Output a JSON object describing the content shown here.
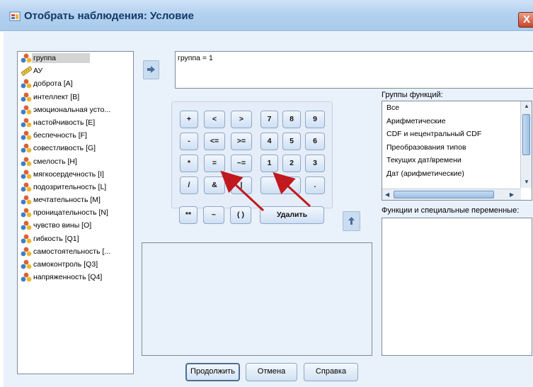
{
  "window": {
    "title": "Отобрать наблюдения: Условие",
    "close_label": "X"
  },
  "variables": [
    {
      "label": "группа",
      "icon": "nominal-variable-icon",
      "selected": true
    },
    {
      "label": "АУ",
      "icon": "scale-variable-icon"
    },
    {
      "label": "доброта [A]",
      "icon": "nominal-variable-icon"
    },
    {
      "label": "интеллект [B]",
      "icon": "nominal-variable-icon"
    },
    {
      "label": "эмоциональная усто...",
      "icon": "nominal-variable-icon"
    },
    {
      "label": "настойчивость [E]",
      "icon": "nominal-variable-icon"
    },
    {
      "label": "беспечность [F]",
      "icon": "nominal-variable-icon"
    },
    {
      "label": "совестливость [G]",
      "icon": "nominal-variable-icon"
    },
    {
      "label": "смелость [H]",
      "icon": "nominal-variable-icon"
    },
    {
      "label": "мягкосердечность [I]",
      "icon": "nominal-variable-icon"
    },
    {
      "label": "подозрительность [L]",
      "icon": "nominal-variable-icon"
    },
    {
      "label": "мечтательность [M]",
      "icon": "nominal-variable-icon"
    },
    {
      "label": "проницательность [N]",
      "icon": "nominal-variable-icon"
    },
    {
      "label": "чувство вины [O]",
      "icon": "nominal-variable-icon"
    },
    {
      "label": "гибкость [Q1]",
      "icon": "nominal-variable-icon"
    },
    {
      "label": "самостоятельность [...",
      "icon": "nominal-variable-icon"
    },
    {
      "label": "самоконтроль [Q3]",
      "icon": "nominal-variable-icon"
    },
    {
      "label": "напряженность [Q4]",
      "icon": "nominal-variable-icon"
    }
  ],
  "expression": "группа = 1",
  "keypad": {
    "plus": "+",
    "lt": "<",
    "gt": ">",
    "k7": "7",
    "k8": "8",
    "k9": "9",
    "minus": "-",
    "le": "<=",
    "ge": ">=",
    "k4": "4",
    "k5": "5",
    "k6": "6",
    "mult": "*",
    "eq": "=",
    "ne": "~=",
    "k1": "1",
    "k2": "2",
    "k3": "3",
    "div": "/",
    "and": "&",
    "or": "|",
    "k0": "0",
    "dot": ".",
    "pow": "**",
    "not": "~",
    "parens": "( )",
    "delete": "Удалить"
  },
  "function_groups": {
    "label": "Группы функций:",
    "items": [
      "Все",
      "Арифметические",
      "CDF и нецентральный CDF",
      "Преобразования типов",
      "Текущих дат/времени",
      "Дат (арифметические)"
    ]
  },
  "functions": {
    "label": "Функции и специальные переменные:"
  },
  "buttons": {
    "continue": "Продолжить",
    "cancel": "Отмена",
    "help": "Справка"
  },
  "colors": {
    "dialog_bg": "#e9f1fb",
    "annotation_arrow": "#c0191e"
  }
}
